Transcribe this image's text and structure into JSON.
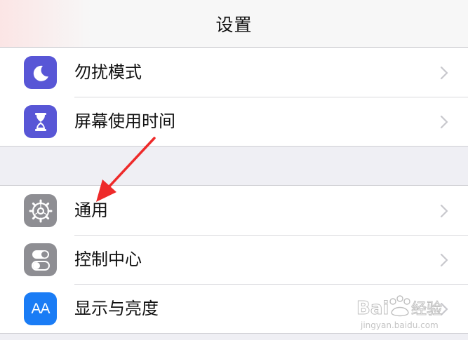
{
  "header": {
    "title": "设置"
  },
  "group1": [
    {
      "label": "勿扰模式",
      "icon": "moon-icon",
      "color": "#5856d6"
    },
    {
      "label": "屏幕使用时间",
      "icon": "hourglass-icon",
      "color": "#5856d6"
    }
  ],
  "group2": [
    {
      "label": "通用",
      "icon": "gear-icon",
      "color": "#8e8e93"
    },
    {
      "label": "控制中心",
      "icon": "toggle-switches-icon",
      "color": "#8e8e93"
    },
    {
      "label": "显示与亮度",
      "icon": "text-size-icon",
      "color": "#1a7cf5",
      "glyph": "AA"
    }
  ],
  "annotation": {
    "type": "red-arrow",
    "points_to": "通用",
    "color": "#ee2a2a"
  },
  "watermark": {
    "brand": "Bai",
    "brand_suffix": "经验",
    "url": "jingyan.baidu.com"
  }
}
